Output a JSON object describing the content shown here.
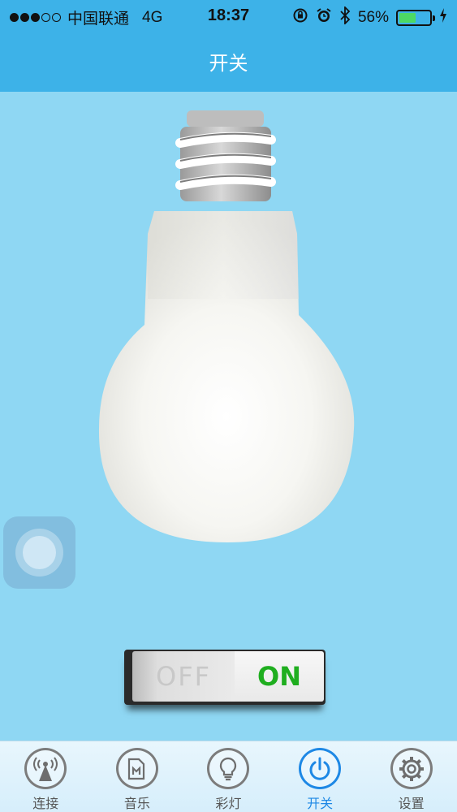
{
  "status_bar": {
    "carrier": "中国联通",
    "network": "4G",
    "time": "18:37",
    "battery": "56%",
    "battery_level": 0.56
  },
  "header": {
    "title": "开关"
  },
  "switch": {
    "off_label": "OFF",
    "on_label": "ON",
    "state": "on"
  },
  "tabs": [
    {
      "label": "连接",
      "icon": "antenna-icon",
      "active": false
    },
    {
      "label": "音乐",
      "icon": "music-icon",
      "active": false
    },
    {
      "label": "彩灯",
      "icon": "bulb-icon",
      "active": false
    },
    {
      "label": "开关",
      "icon": "power-icon",
      "active": true
    },
    {
      "label": "设置",
      "icon": "gear-icon",
      "active": false
    }
  ],
  "colors": {
    "header": "#3db2e8",
    "background": "#8fd7f3",
    "accent": "#1e88e5",
    "on_text": "#1fae1f"
  }
}
